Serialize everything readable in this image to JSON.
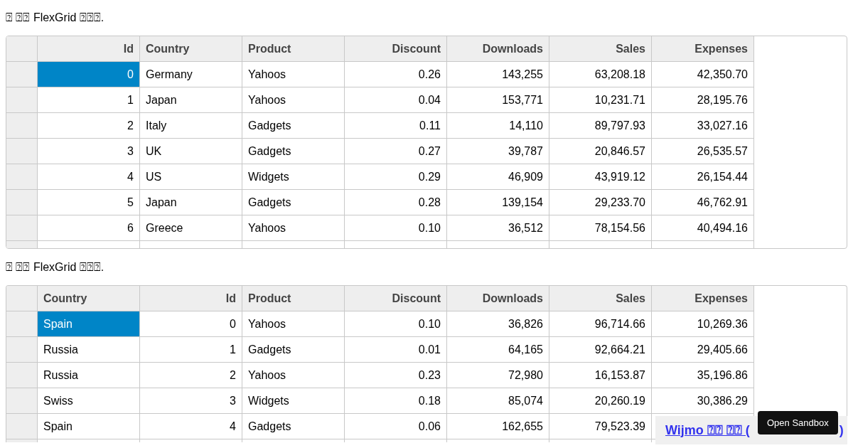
{
  "grids": [
    {
      "caption": "⍰ ⍰⍰ FlexGrid ⍰⍰⍰.",
      "columns": [
        {
          "label": "Id",
          "numeric": true
        },
        {
          "label": "Country",
          "numeric": false
        },
        {
          "label": "Product",
          "numeric": false
        },
        {
          "label": "Discount",
          "numeric": true
        },
        {
          "label": "Downloads",
          "numeric": true
        },
        {
          "label": "Sales",
          "numeric": true
        },
        {
          "label": "Expenses",
          "numeric": true
        }
      ],
      "rows": [
        {
          "cells": [
            {
              "text": "0",
              "selected": true
            },
            {
              "text": "Germany",
              "selected": false
            },
            {
              "text": "Yahoos",
              "selected": false
            },
            {
              "text": "0.26",
              "selected": false
            },
            {
              "text": "143,255",
              "selected": false
            },
            {
              "text": "63,208.18",
              "selected": false
            },
            {
              "text": "42,350.70",
              "selected": false
            }
          ]
        },
        {
          "cells": [
            {
              "text": "1",
              "selected": false
            },
            {
              "text": "Japan",
              "selected": false
            },
            {
              "text": "Yahoos",
              "selected": false
            },
            {
              "text": "0.04",
              "selected": false
            },
            {
              "text": "153,771",
              "selected": false
            },
            {
              "text": "10,231.71",
              "selected": false
            },
            {
              "text": "28,195.76",
              "selected": false
            }
          ]
        },
        {
          "cells": [
            {
              "text": "2",
              "selected": false
            },
            {
              "text": "Italy",
              "selected": false
            },
            {
              "text": "Gadgets",
              "selected": false
            },
            {
              "text": "0.11",
              "selected": false
            },
            {
              "text": "14,110",
              "selected": false
            },
            {
              "text": "89,797.93",
              "selected": false
            },
            {
              "text": "33,027.16",
              "selected": false
            }
          ]
        },
        {
          "cells": [
            {
              "text": "3",
              "selected": false
            },
            {
              "text": "UK",
              "selected": false
            },
            {
              "text": "Gadgets",
              "selected": false
            },
            {
              "text": "0.27",
              "selected": false
            },
            {
              "text": "39,787",
              "selected": false
            },
            {
              "text": "20,846.57",
              "selected": false
            },
            {
              "text": "26,535.57",
              "selected": false
            }
          ]
        },
        {
          "cells": [
            {
              "text": "4",
              "selected": false
            },
            {
              "text": "US",
              "selected": false
            },
            {
              "text": "Widgets",
              "selected": false
            },
            {
              "text": "0.29",
              "selected": false
            },
            {
              "text": "46,909",
              "selected": false
            },
            {
              "text": "43,919.12",
              "selected": false
            },
            {
              "text": "26,154.44",
              "selected": false
            }
          ]
        },
        {
          "cells": [
            {
              "text": "5",
              "selected": false
            },
            {
              "text": "Japan",
              "selected": false
            },
            {
              "text": "Gadgets",
              "selected": false
            },
            {
              "text": "0.28",
              "selected": false
            },
            {
              "text": "139,154",
              "selected": false
            },
            {
              "text": "29,233.70",
              "selected": false
            },
            {
              "text": "46,762.91",
              "selected": false
            }
          ]
        },
        {
          "cells": [
            {
              "text": "6",
              "selected": false
            },
            {
              "text": "Greece",
              "selected": false
            },
            {
              "text": "Yahoos",
              "selected": false
            },
            {
              "text": "0.10",
              "selected": false
            },
            {
              "text": "36,512",
              "selected": false
            },
            {
              "text": "78,154.56",
              "selected": false
            },
            {
              "text": "40,494.16",
              "selected": false
            }
          ]
        }
      ]
    },
    {
      "caption": "⍰ ⍰⍰ FlexGrid ⍰⍰⍰.",
      "columns": [
        {
          "label": "Country",
          "numeric": false
        },
        {
          "label": "Id",
          "numeric": true
        },
        {
          "label": "Product",
          "numeric": false
        },
        {
          "label": "Discount",
          "numeric": true
        },
        {
          "label": "Downloads",
          "numeric": true
        },
        {
          "label": "Sales",
          "numeric": true
        },
        {
          "label": "Expenses",
          "numeric": true
        }
      ],
      "rows": [
        {
          "cells": [
            {
              "text": "Spain",
              "selected": true
            },
            {
              "text": "0",
              "selected": false
            },
            {
              "text": "Yahoos",
              "selected": false
            },
            {
              "text": "0.10",
              "selected": false
            },
            {
              "text": "36,826",
              "selected": false
            },
            {
              "text": "96,714.66",
              "selected": false
            },
            {
              "text": "10,269.36",
              "selected": false
            }
          ]
        },
        {
          "cells": [
            {
              "text": "Russia",
              "selected": false
            },
            {
              "text": "1",
              "selected": false
            },
            {
              "text": "Gadgets",
              "selected": false
            },
            {
              "text": "0.01",
              "selected": false
            },
            {
              "text": "64,165",
              "selected": false
            },
            {
              "text": "92,664.21",
              "selected": false
            },
            {
              "text": "29,405.66",
              "selected": false
            }
          ]
        },
        {
          "cells": [
            {
              "text": "Russia",
              "selected": false
            },
            {
              "text": "2",
              "selected": false
            },
            {
              "text": "Yahoos",
              "selected": false
            },
            {
              "text": "0.23",
              "selected": false
            },
            {
              "text": "72,980",
              "selected": false
            },
            {
              "text": "16,153.87",
              "selected": false
            },
            {
              "text": "35,196.86",
              "selected": false
            }
          ]
        },
        {
          "cells": [
            {
              "text": "Swiss",
              "selected": false
            },
            {
              "text": "3",
              "selected": false
            },
            {
              "text": "Widgets",
              "selected": false
            },
            {
              "text": "0.18",
              "selected": false
            },
            {
              "text": "85,074",
              "selected": false
            },
            {
              "text": "20,260.19",
              "selected": false
            },
            {
              "text": "30,386.29",
              "selected": false
            }
          ]
        },
        {
          "cells": [
            {
              "text": "Spain",
              "selected": false
            },
            {
              "text": "4",
              "selected": false
            },
            {
              "text": "Gadgets",
              "selected": false
            },
            {
              "text": "0.06",
              "selected": false
            },
            {
              "text": "162,655",
              "selected": false
            },
            {
              "text": "79,523.39",
              "selected": false
            },
            {
              "selected": false
            }
          ]
        }
      ]
    }
  ],
  "footer": {
    "link_text": "Wijmo ⍰⍰ ⍰⍰ (",
    "link_end": ")"
  },
  "tooltip": {
    "text": "Open Sandbox"
  }
}
